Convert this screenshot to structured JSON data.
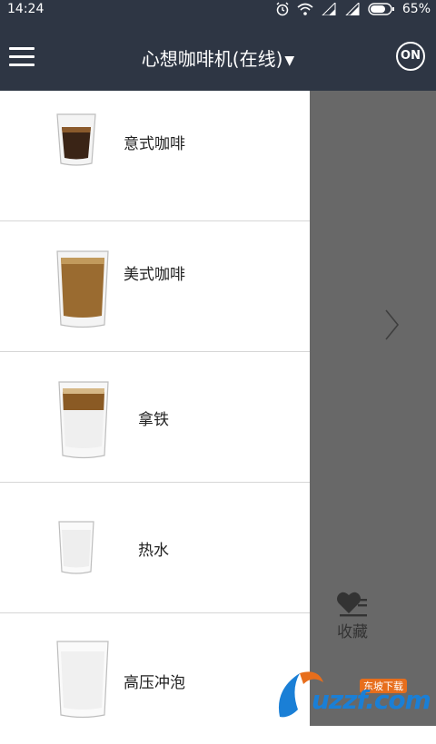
{
  "status_bar": {
    "time": "14:24",
    "battery": "65%"
  },
  "header": {
    "title": "心想咖啡机(在线)",
    "power_label": "ON"
  },
  "drinks": [
    {
      "name": "意式咖啡"
    },
    {
      "name": "美式咖啡"
    },
    {
      "name": "拿铁"
    },
    {
      "name": "热水"
    },
    {
      "name": "高压冲泡"
    }
  ],
  "side_panel": {
    "favorite_label": "收藏"
  },
  "watermark": {
    "text": "uzzf.com",
    "badge": "东坡下载"
  },
  "colors": {
    "header_bg": "#2e3644",
    "panel_bg": "#686868",
    "coffee": "#9a6b30",
    "espresso": "#3a2416"
  }
}
